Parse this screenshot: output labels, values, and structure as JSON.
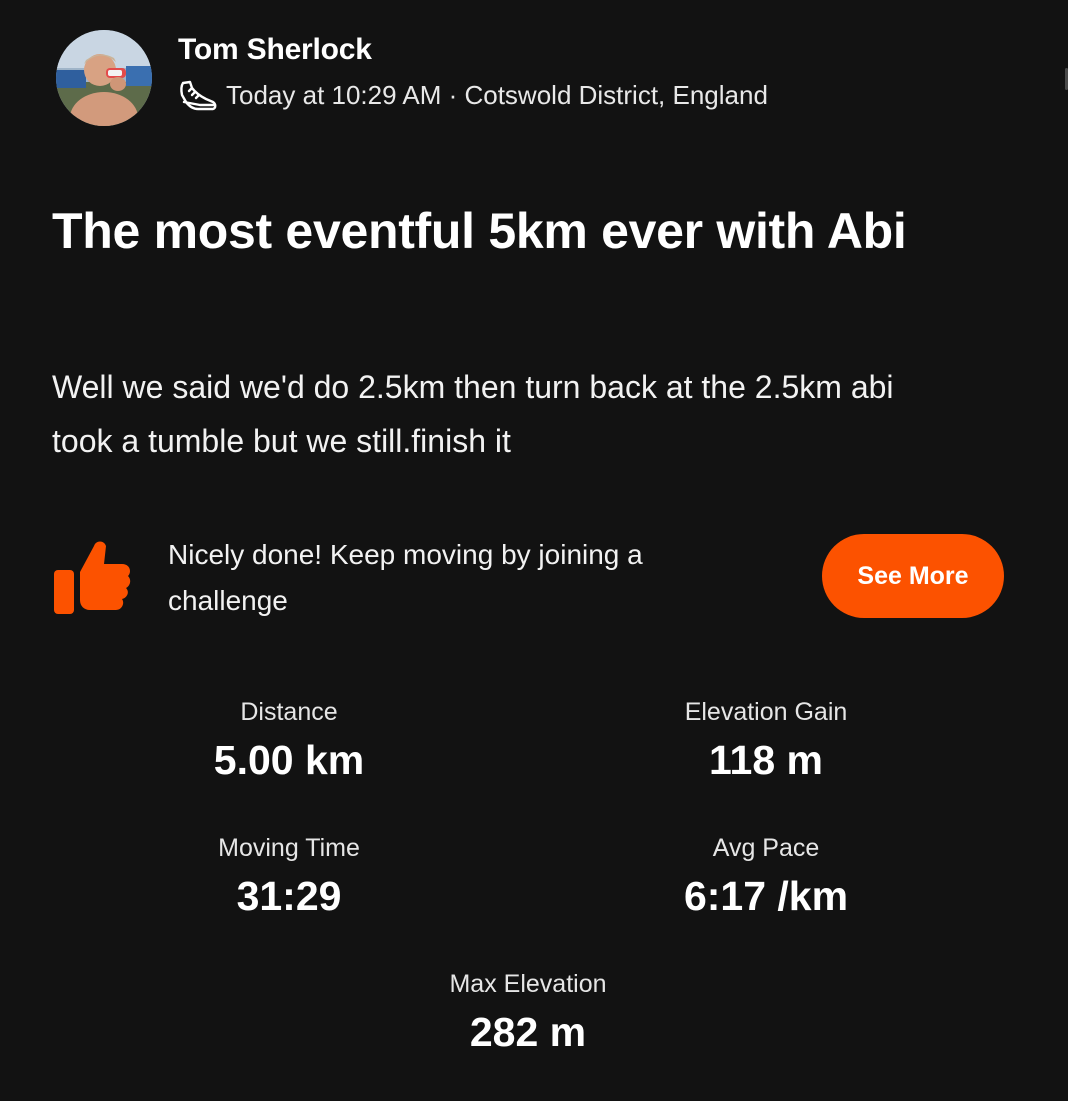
{
  "header": {
    "athlete_name": "Tom Sherlock",
    "activity_icon": "running-shoe-icon",
    "timestamp_location": "Today at 10:29 AM · Cotswold District, England"
  },
  "activity": {
    "title": "The most eventful 5km ever with Abi",
    "description": "Well we said we'd do 2.5km then turn back at the 2.5km abi took a tumble but we still.finish it"
  },
  "promo": {
    "icon": "thumbs-up-icon",
    "text": "Nicely done! Keep moving by joining a challenge",
    "button_label": "See More"
  },
  "stats": {
    "distance": {
      "label": "Distance",
      "value": "5.00 km"
    },
    "elevation_gain": {
      "label": "Elevation Gain",
      "value": "118 m"
    },
    "moving_time": {
      "label": "Moving Time",
      "value": "31:29"
    },
    "avg_pace": {
      "label": "Avg Pace",
      "value": "6:17 /km"
    },
    "max_elevation": {
      "label": "Max Elevation",
      "value": "282 m"
    }
  },
  "colors": {
    "background": "#121212",
    "accent": "#fc5200",
    "text": "#ffffff"
  }
}
